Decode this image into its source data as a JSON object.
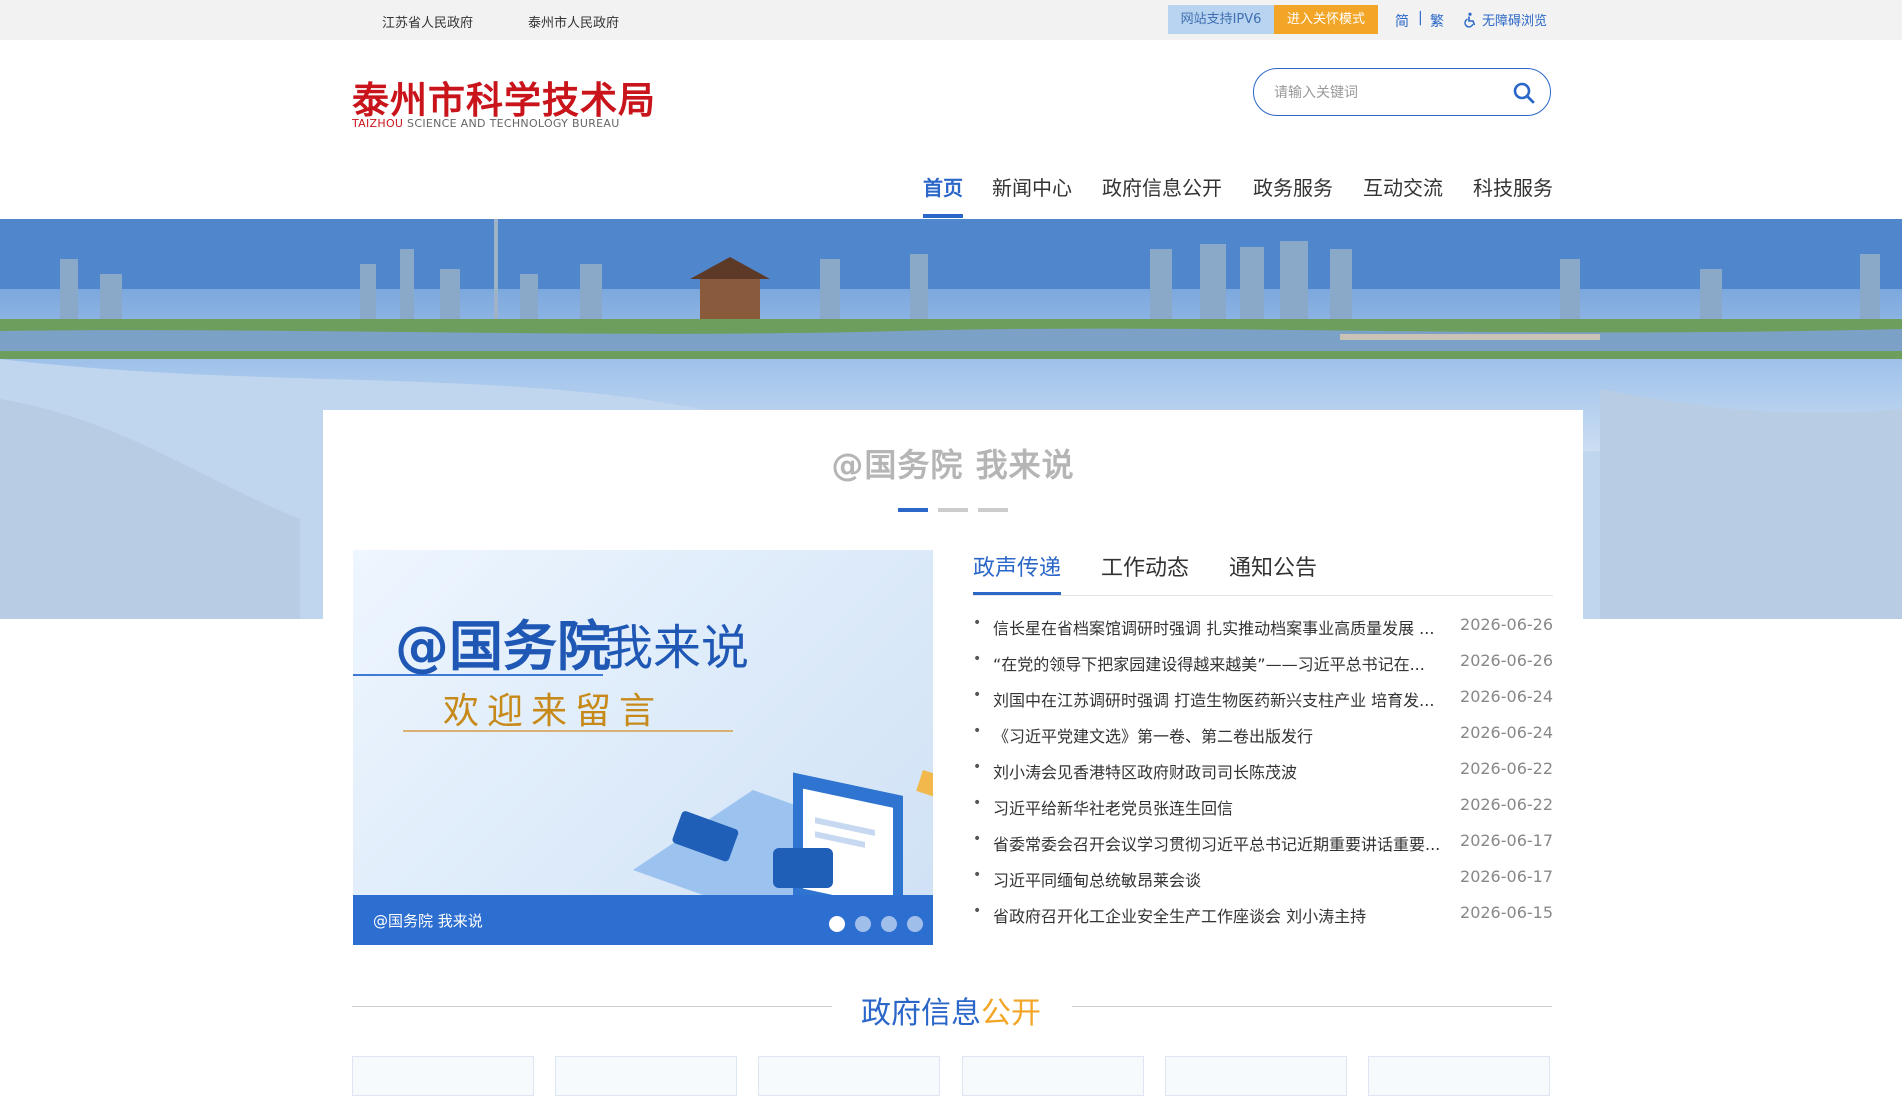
{
  "topbar": {
    "links": [
      "江苏省人民政府",
      "泰州市人民政府"
    ],
    "ipv6": "网站支持IPV6",
    "care_mode": "进入关怀模式",
    "lang_simplified": "简",
    "lang_separator": "|",
    "lang_traditional": "繁",
    "accessibility": "无障碍浏览"
  },
  "header": {
    "logo_cn": "泰州市科学技术局",
    "logo_en_red": "TAIZHOU",
    "logo_en_rest": " SCIENCE AND TECHNOLOGY BUREAU",
    "search_placeholder": "请输入关键词"
  },
  "nav": {
    "items": [
      "首页",
      "新闻中心",
      "政府信息公开",
      "政务服务",
      "互动交流",
      "科技服务"
    ],
    "active": "首页"
  },
  "feature": {
    "title": "@国务院 我来说",
    "slide_main_a": "@国务院",
    "slide_main_b": "我来说",
    "slide_welcome": "欢迎来留言",
    "slide_caption": "@国务院 我来说"
  },
  "tabs": [
    "政声传递",
    "工作动态",
    "通知公告"
  ],
  "news": [
    {
      "title": "信长星在省档案馆调研时强调 扎实推动档案事业高质量发展 ...",
      "date": "2026-06-26"
    },
    {
      "title": "“在党的领导下把家园建设得越来越美”——习近平总书记在...",
      "date": "2026-06-26"
    },
    {
      "title": "刘国中在江苏调研时强调 打造生物医药新兴支柱产业 培育发...",
      "date": "2026-06-24"
    },
    {
      "title": "《习近平党建文选》第一卷、第二卷出版发行",
      "date": "2026-06-24"
    },
    {
      "title": "刘小涛会见香港特区政府财政司司长陈茂波",
      "date": "2026-06-22"
    },
    {
      "title": "习近平给新华社老党员张连生回信",
      "date": "2026-06-22"
    },
    {
      "title": "省委常委会召开会议学习贯彻习近平总书记近期重要讲话重要...",
      "date": "2026-06-17"
    },
    {
      "title": "习近平同缅甸总统敏昂莱会谈",
      "date": "2026-06-17"
    },
    {
      "title": "省政府召开化工企业安全生产工作座谈会 刘小涛主持",
      "date": "2026-06-15"
    }
  ],
  "gov_info": {
    "title_blue": "政府信息",
    "title_orange": "公开"
  },
  "colors": {
    "brand_blue": "#2a67c8",
    "logo_red": "#c9141b",
    "accent_orange": "#f2a526"
  }
}
